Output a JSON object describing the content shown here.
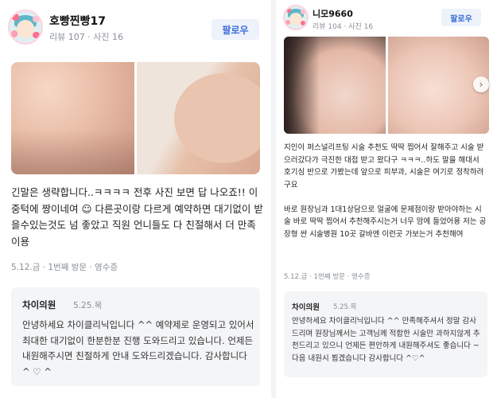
{
  "left_review": {
    "nickname": "호빵찐빵17",
    "stats": "리뷰 107 · 사진 16",
    "follow_label": "팔로우",
    "body": "긴말은 생략합니다..ㅋㅋㅋㅋ 전후 사진 보면 답 나오죠!! 이중턱에 짱이네여 ☺ 다른곳이랑 다르게 예약하면 대기없이 받을수있는것도 넘 좋았고 직원 언니들도 다 친절해서 더 만족이용",
    "meta": "5.12.금 · 1번째 방문 · 영수증",
    "reply": {
      "name": "차이의원",
      "date": "5.25.목",
      "text": "안녕하세요 차이클리닉입니다 ^^ 예약제로 운영되고 있어서 최대한 대기없이 한분한분 진행 도와드리고 있습니다. 언제든 내원해주시면 친절하게 안내 도와드리겠습니다. 감사합니다 ^ ♡ ^"
    }
  },
  "right_review": {
    "nickname": "니모9660",
    "stats": "리뷰 104 · 사진 16",
    "follow_label": "팔로우",
    "body": "지인이 퍼스널리프팅 시술 추천도 딱딱 찝어서 잘해주고 시술 받으러갔다가 극진한 대접 받고 왔다구 ㅋㅋㅋ..하도 말을 해대서 호기심 반으로 가봤는데 앞으로 피부과, 시술은 여기로 정착하려구요\n\n바로 원장님과 1대1상담으로 얼굴에 문제점이랑 받아야하는 시술 바로 딱딱 찝어서 추천해주시는거 너무 맘에 들었어용 저는 공장형 싼 시술병원 10곳 갈바엔 이런곳 가보는거 추천해여",
    "meta": "5.12.금 · 1번째 방문 · 영수증",
    "reply": {
      "name": "차이의원",
      "date": "5.25.목",
      "text": "안녕하세요 차이클리닉입니다 ^^ 만족해주셔서 정말 감사드리며 원장님께서는 고객님께 적합한 시술만 과하지않게 추천드리고 있으니 언제든 편안하게 내원해주셔도 좋습니다 ~ 다음 내원시 뵙겠습니다 감사합니다 ^♡^"
    }
  },
  "icons": {
    "next": "›"
  }
}
